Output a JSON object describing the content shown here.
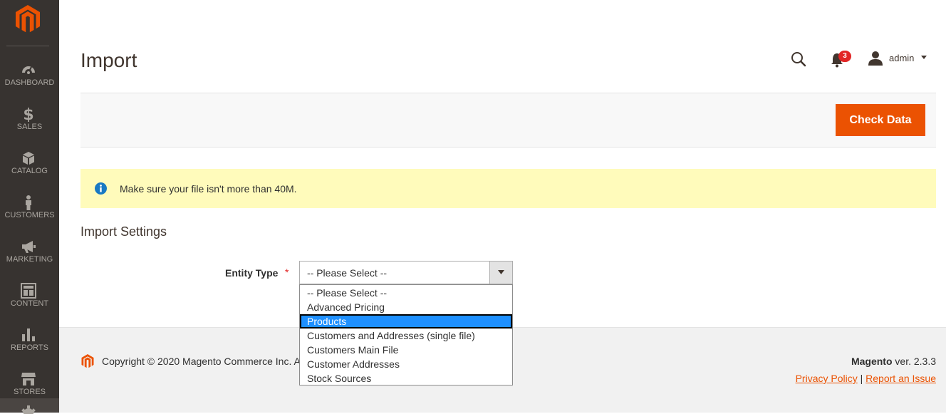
{
  "sidebar": {
    "items": [
      {
        "label": "DASHBOARD",
        "icon": "dashboard-icon"
      },
      {
        "label": "SALES",
        "icon": "dollar-icon"
      },
      {
        "label": "CATALOG",
        "icon": "cube-icon"
      },
      {
        "label": "CUSTOMERS",
        "icon": "person-icon"
      },
      {
        "label": "MARKETING",
        "icon": "megaphone-icon"
      },
      {
        "label": "CONTENT",
        "icon": "layout-icon"
      },
      {
        "label": "REPORTS",
        "icon": "bar-chart-icon"
      },
      {
        "label": "STORES",
        "icon": "storefront-icon"
      }
    ]
  },
  "header": {
    "title": "Import",
    "notifications_count": "3",
    "user_name": "admin"
  },
  "actions": {
    "check_data_label": "Check Data"
  },
  "message": {
    "text": "Make sure your file isn't more than 40M."
  },
  "section": {
    "title": "Import Settings",
    "entity_type_label": "Entity Type",
    "required_mark": "*",
    "selected_value": "-- Please Select --",
    "options": [
      "-- Please Select --",
      "Advanced Pricing",
      "Products",
      "Customers and Addresses (single file)",
      "Customers Main File",
      "Customer Addresses",
      "Stock Sources"
    ],
    "highlighted_option": "Products"
  },
  "footer": {
    "copyright": "Copyright © 2020 Magento Commerce Inc. All rights reserved.",
    "brand": "Magento",
    "version": " ver. 2.3.3",
    "privacy_label": "Privacy Policy",
    "separator": "|",
    "report_label": "Report an Issue"
  },
  "colors": {
    "sidebar_bg": "#373330",
    "accent": "#eb5202",
    "message_bg": "#fffbbb",
    "badge": "#e22626",
    "highlight": "#1e90ff"
  }
}
